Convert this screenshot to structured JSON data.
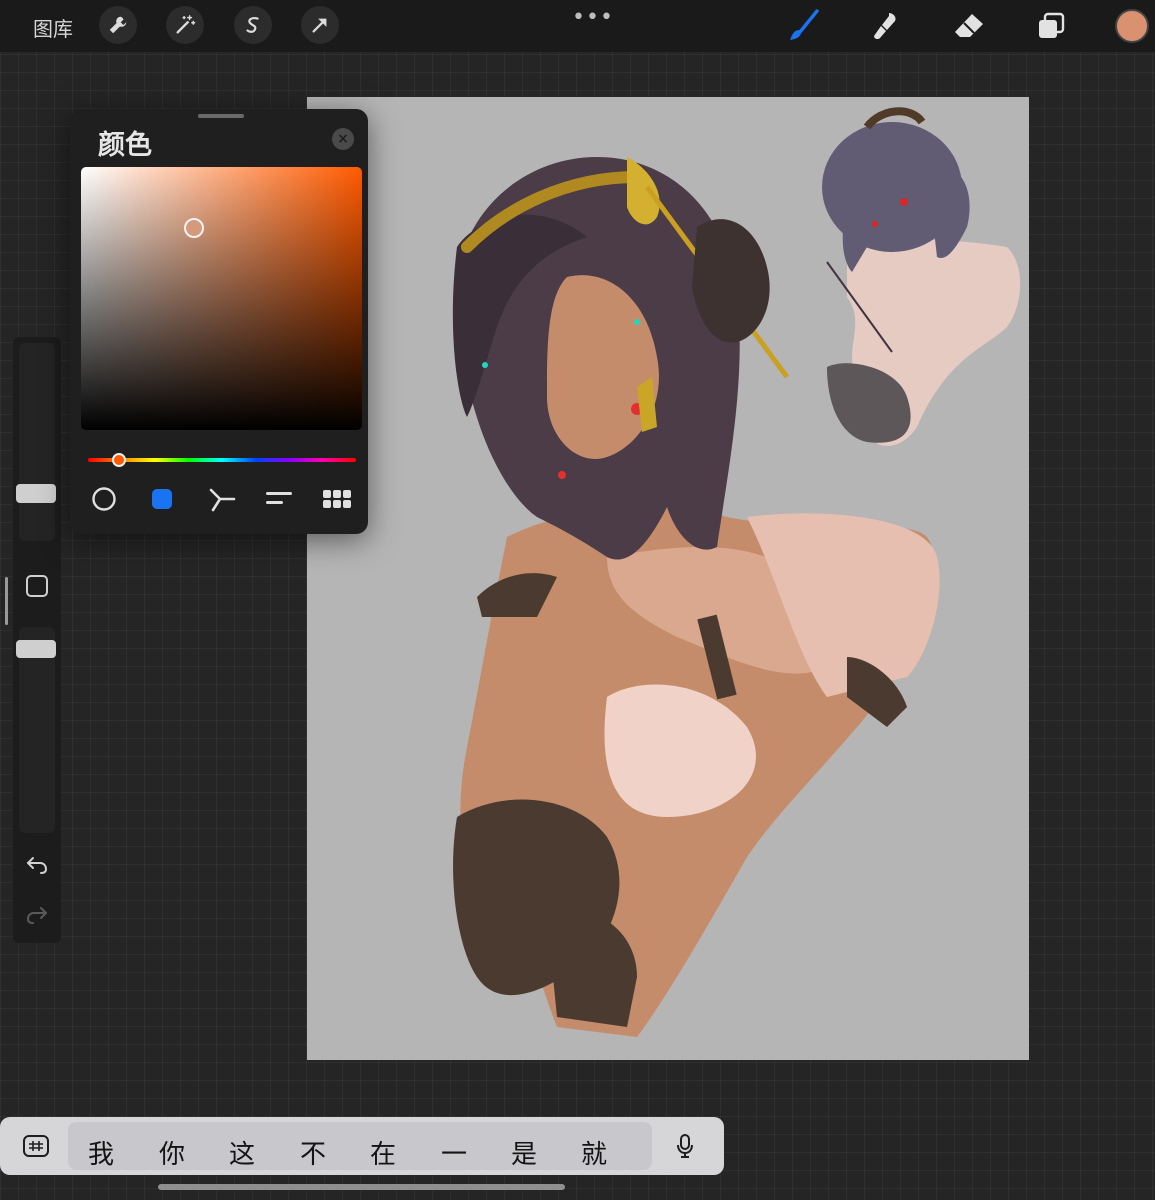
{
  "toolbar": {
    "gallery_label": "图库",
    "left_tools": [
      "wrench-icon",
      "magic-wand-icon",
      "selection-icon",
      "transform-arrow-icon"
    ],
    "more_label": "•••",
    "right_tools": [
      "brush-icon",
      "smudge-icon",
      "eraser-icon",
      "layers-icon"
    ],
    "active_tool": "brush",
    "accent_color": "#1a74f2",
    "current_color": "#d99170"
  },
  "color_panel": {
    "title": "颜色",
    "close_label": "×",
    "hue_color": "#ff5a00",
    "selected_color": "#d59a7c",
    "modes": [
      "disc-mode-icon",
      "classic-mode-icon",
      "harmony-mode-icon",
      "value-mode-icon",
      "palettes-mode-icon"
    ],
    "active_mode": "classic"
  },
  "sidebar": {
    "controls": [
      "brush-size-slider",
      "modify-button",
      "opacity-slider",
      "undo-icon",
      "redo-icon"
    ]
  },
  "keyboard": {
    "candidates": [
      "我",
      "你",
      "这",
      "不",
      "在",
      "一",
      "是",
      "就"
    ]
  }
}
